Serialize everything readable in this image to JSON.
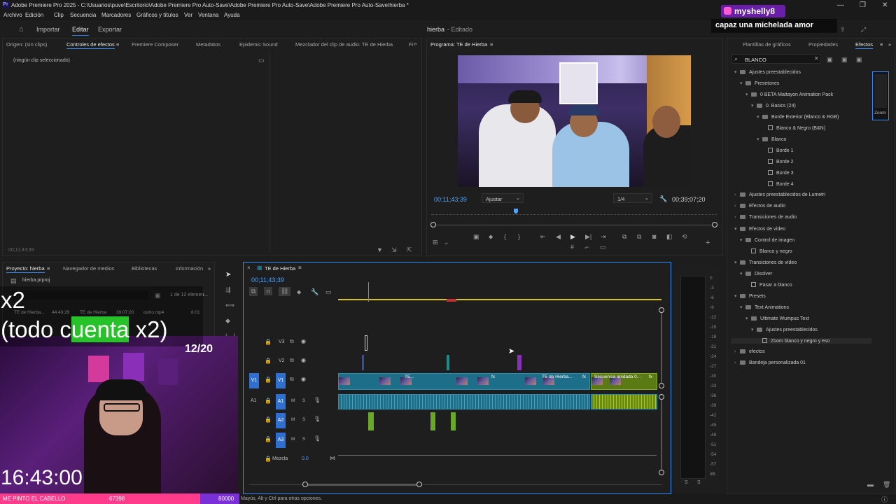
{
  "window": {
    "title": "Adobe Premiere Pro 2025 - C:\\Usuarios\\puve\\Escritorio\\Adobe Premiere Pro Auto-Save\\Adobe Premiere Pro Auto-Save\\Adobe Premiere Pro Auto-Save\\hierba *",
    "logo": "Pr"
  },
  "menu": [
    "Archivo",
    "Edición",
    "Clip",
    "Secuencia",
    "Marcadores",
    "Gráficos y títulos",
    "Ver",
    "Ventana",
    "Ayuda"
  ],
  "workspace": {
    "tabs": [
      "Importar",
      "Editar",
      "Exportar"
    ],
    "active": "Editar",
    "project_title": "hierba",
    "edited_status": "- Editado"
  },
  "effects_panel": {
    "tabs": [
      "Origen: (sin clips)",
      "Controles de efectos",
      "Premiere Composer",
      "Metadatos",
      "Epidemic Sound",
      "Mezclador del clip de audio: TE de Hierba",
      "Fi"
    ],
    "empty_message": "(ningún clip seleccionado)",
    "timecode": "00;11;43;39"
  },
  "program_monitor": {
    "tab": "Programa: TE de Hierba",
    "timecode": "00;11;43;39",
    "fit": "Ajustar",
    "resolution": "1/4",
    "duration": "00;39;07;20"
  },
  "effects_library": {
    "tabs": [
      "Plantillas de gráficos",
      "Propiedades",
      "Efectos"
    ],
    "search_value": "BLANCO",
    "tree": [
      {
        "label": "Ajustes preestablecidos",
        "level": 0,
        "type": "folder",
        "open": true
      },
      {
        "label": "Presetones",
        "level": 1,
        "type": "folder",
        "open": true
      },
      {
        "label": "0 BETA Mattayon Animation Pack",
        "level": 2,
        "type": "folder",
        "open": true
      },
      {
        "label": "0. Basics (24)",
        "level": 3,
        "type": "folder",
        "open": true
      },
      {
        "label": "Borde Exterior (Blanco & RGB)",
        "level": 4,
        "type": "folder",
        "open": true
      },
      {
        "label": "Blanco & Negro (B&N)",
        "level": 5,
        "type": "fx"
      },
      {
        "label": "Blanco",
        "level": 4,
        "type": "folder",
        "open": true
      },
      {
        "label": "Borde 1",
        "level": 5,
        "type": "fx"
      },
      {
        "label": "Borde 2",
        "level": 5,
        "type": "fx"
      },
      {
        "label": "Borde 3",
        "level": 5,
        "type": "fx"
      },
      {
        "label": "Borde 4",
        "level": 5,
        "type": "fx"
      },
      {
        "label": "Ajustes preestablecidos de Lumetri",
        "level": 0,
        "type": "folder",
        "open": false
      },
      {
        "label": "Efectos de audio",
        "level": 0,
        "type": "folder",
        "open": false
      },
      {
        "label": "Transiciones de audio",
        "level": 0,
        "type": "folder",
        "open": false
      },
      {
        "label": "Efectos de vídeo",
        "level": 0,
        "type": "folder",
        "open": true
      },
      {
        "label": "Control de imagen",
        "level": 1,
        "type": "folder",
        "open": true
      },
      {
        "label": "Blanco y negro",
        "level": 2,
        "type": "fx"
      },
      {
        "label": "Transiciones de vídeo",
        "level": 0,
        "type": "folder",
        "open": true
      },
      {
        "label": "Disolver",
        "level": 1,
        "type": "folder",
        "open": true
      },
      {
        "label": "Pasar a blanco",
        "level": 2,
        "type": "fx"
      },
      {
        "label": "Presets",
        "level": 0,
        "type": "folder",
        "open": true
      },
      {
        "label": "Text Animations",
        "level": 1,
        "type": "folder",
        "open": true
      },
      {
        "label": "Ultimate Wumpus Text",
        "level": 2,
        "type": "folder",
        "open": true
      },
      {
        "label": "Ajustes preestablecidos",
        "level": 3,
        "type": "folder",
        "open": true
      },
      {
        "label": "Zoom blanco y negro y eso",
        "level": 4,
        "type": "fx",
        "selected": true
      },
      {
        "label": "efectos",
        "level": 0,
        "type": "folder",
        "open": false
      },
      {
        "label": "Bandeja personalizada 01",
        "level": 0,
        "type": "folder",
        "open": false
      }
    ],
    "preview_label": "Zoom"
  },
  "project_panel": {
    "tabs": [
      "Proyecto: hierba",
      "Navegador de medios",
      "Bibliotecas",
      "Información"
    ],
    "file": "hierba.prproj",
    "count": "1 de 12 elemen...",
    "row": [
      "TE de Hierba...",
      "44:43:29",
      "TE de Hierba",
      "39:07:20",
      "outro.mp4",
      "8:01"
    ]
  },
  "timeline": {
    "tab": "TE de Hierba",
    "timecode": "00;11;43;39",
    "video_tracks": [
      "V3",
      "V2",
      "V1"
    ],
    "audio_tracks": [
      "A1",
      "A2",
      "A3"
    ],
    "mix_label": "Mezcla",
    "mix_value": "0.0",
    "clip_label_1": "TE...",
    "clip_label_2": "TE de Hierba...",
    "clip_label_3": "Secuencia anidada 0...",
    "fx": "fx"
  },
  "meter": {
    "scale": [
      "0",
      "-3",
      "-6",
      "-9",
      "-12",
      "-15",
      "-18",
      "-21",
      "-24",
      "-27",
      "-30",
      "-33",
      "-36",
      "-39",
      "-42",
      "-45",
      "-48",
      "-51",
      "-54",
      "-57",
      "dB"
    ],
    "solo": [
      "S",
      "S"
    ]
  },
  "status": {
    "hint": "Mayús, Alt y Ctrl para otras opciones."
  },
  "stream_overlay": {
    "chat_user": "myshelly8",
    "chat_message": "capaz una michelada amor",
    "multiplier": "x2",
    "goal_text_pre": "(todo c",
    "goal_text_hl": "uenta",
    "goal_text_post": " x2)",
    "counter": "12/20",
    "clock": "16:43:00",
    "bottom_left": "ME PINTO EL CABELLO",
    "bottom_mid": "67398",
    "bottom_right": "80000"
  },
  "colors": {
    "accent": "#2f8cff",
    "clip": "#1c6e89",
    "nested_clip": "#7a9a1a",
    "pink_bar": "#ff3b8b",
    "purple_bar": "#7b2fd6"
  }
}
